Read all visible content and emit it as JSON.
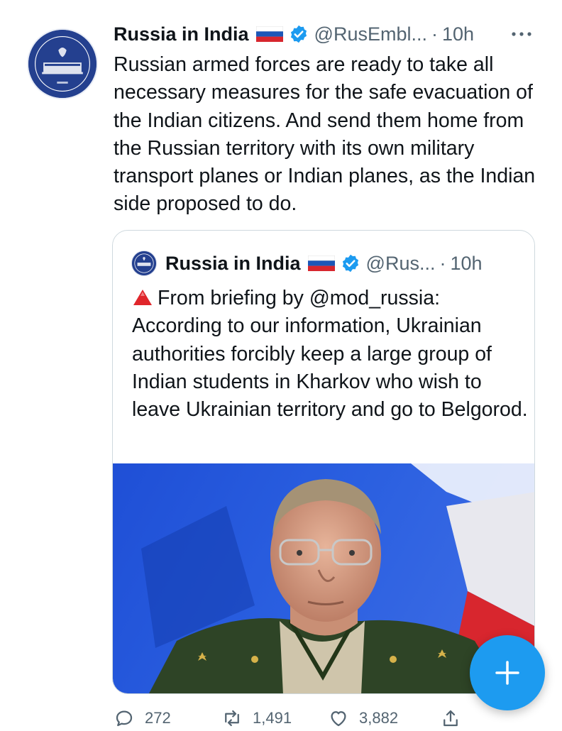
{
  "tweet": {
    "author_name": "Russia in India",
    "author_handle": "@RusEmbl...",
    "separator": "·",
    "time": "10h",
    "text": "Russian armed forces are ready to take all necessary measures for the safe evacuation of the Indian citizens. And send them home from the Russian territory with its own military transport planes or Indian planes, as the Indian side proposed to do.",
    "avatar_icon": "embassy-seal-icon",
    "verified_icon": "verified-badge-icon",
    "flag_icon": "russia-flag-icon"
  },
  "quote": {
    "author_name": "Russia in India",
    "author_handle": "@Rus...",
    "separator": "·",
    "time": "10h",
    "prefix_icon": "red-triangle-icon",
    "text": "From briefing by @mod_russia: According to our information, Ukrainian authorities forcibly keep a large group of Indian students in Kharkov who wish to leave Ukrainian territory and go to Belgorod."
  },
  "actions": {
    "replies": "272",
    "retweets": "1,491",
    "likes": "3,882"
  },
  "fab": {
    "icon": "plus-icon"
  },
  "colors": {
    "accent": "#1d9bf0",
    "text": "#0f1419",
    "muted": "#536471",
    "border": "#cfd9de"
  }
}
